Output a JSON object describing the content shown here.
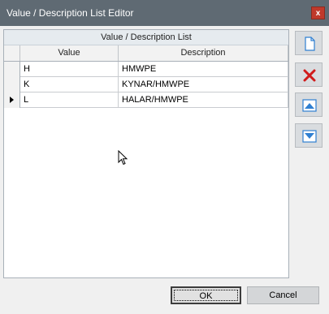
{
  "window": {
    "title": "Value / Description List Editor",
    "close_label": "x"
  },
  "grid": {
    "group_header": "Value / Description List",
    "columns": [
      "Value",
      "Description"
    ],
    "rows": [
      {
        "value": "H",
        "description": "HMWPE",
        "current": false
      },
      {
        "value": "K",
        "description": "KYNAR/HMWPE",
        "current": false
      },
      {
        "value": "L",
        "description": "HALAR/HMWPE",
        "current": true
      }
    ]
  },
  "toolbar": {
    "new_icon": "new-document-icon",
    "delete_icon": "delete-x-icon",
    "move_up_icon": "move-up-icon",
    "move_down_icon": "move-down-icon",
    "delete_color": "#d01b1b",
    "accent_color": "#2f7fd1"
  },
  "buttons": {
    "ok_label": "OK",
    "cancel_label": "Cancel"
  }
}
